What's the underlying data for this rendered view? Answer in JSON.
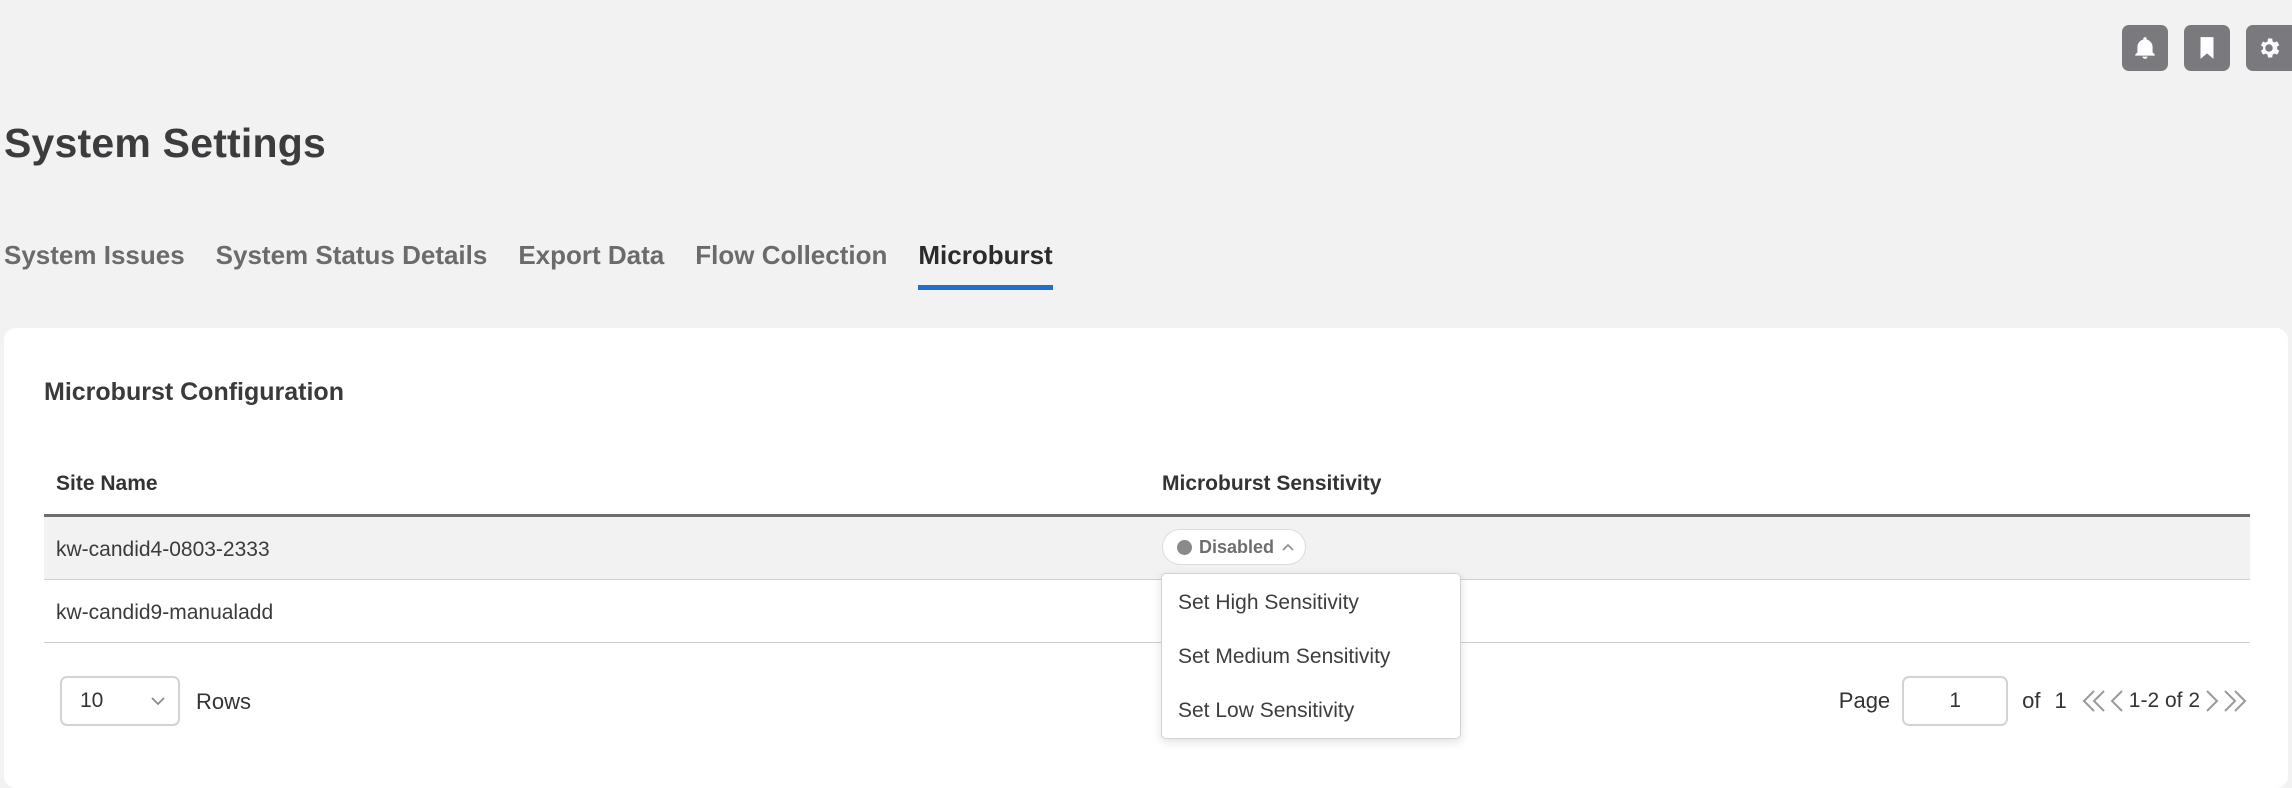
{
  "header": {
    "icons": [
      "bell-icon",
      "bookmark-icon",
      "gear-icon"
    ]
  },
  "page": {
    "title": "System Settings"
  },
  "tabs": [
    {
      "label": "System Issues"
    },
    {
      "label": "System Status Details"
    },
    {
      "label": "Export Data"
    },
    {
      "label": "Flow Collection"
    },
    {
      "label": "Microburst",
      "active": true
    }
  ],
  "card": {
    "title": "Microburst Configuration",
    "columns": [
      "Site Name",
      "Microburst Sensitivity"
    ],
    "rows": [
      {
        "site": "kw-candid4-0803-2333",
        "sensitivity": "Disabled"
      },
      {
        "site": "kw-candid9-manualadd",
        "sensitivity": ""
      }
    ]
  },
  "dropdown": {
    "options": [
      "Set High Sensitivity",
      "Set Medium Sensitivity",
      "Set Low Sensitivity"
    ]
  },
  "footer": {
    "rows_per_page": "10",
    "rows_label": "Rows",
    "page_label": "Page",
    "page_value": "1",
    "of_label": "of",
    "total_pages": "1",
    "range": "1-2 of 2"
  },
  "colors": {
    "accent": "#1f6fcf",
    "icon_bg": "#7a7a7e",
    "status_disabled": "#8a8a8a"
  }
}
